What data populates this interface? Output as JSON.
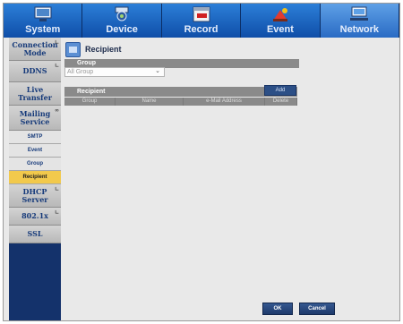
{
  "tabs": [
    {
      "label": "System",
      "icon": "monitor-icon",
      "active": false
    },
    {
      "label": "Device",
      "icon": "camera-icon",
      "active": false
    },
    {
      "label": "Record",
      "icon": "calendar-rec-icon",
      "active": false
    },
    {
      "label": "Event",
      "icon": "event-icon",
      "active": false
    },
    {
      "label": "Network",
      "icon": "network-icon",
      "active": true
    }
  ],
  "sidebar": {
    "items": [
      {
        "label": "Connection Mode"
      },
      {
        "label": "DDNS"
      },
      {
        "label": "Live Transfer"
      },
      {
        "label": "Mailing Service"
      },
      {
        "label": "SMTP"
      },
      {
        "label": "Event"
      },
      {
        "label": "Group"
      },
      {
        "label": "Recipient"
      },
      {
        "label": "DHCP Server"
      },
      {
        "label": "802.1x"
      },
      {
        "label": "SSL"
      }
    ]
  },
  "main": {
    "title": "Recipient",
    "group_label": "Group",
    "group_value": "All Group",
    "recipient_label": "Recipient",
    "add_label": "Add",
    "columns": [
      "Group",
      "Name",
      "e-Mail Address",
      "Delete"
    ],
    "ok_label": "OK",
    "cancel_label": "Cancel"
  },
  "colors": {
    "tab_blue": "#0f4ea8",
    "sidebar_navy": "#14326b",
    "selected_item": "#f2c94c"
  }
}
